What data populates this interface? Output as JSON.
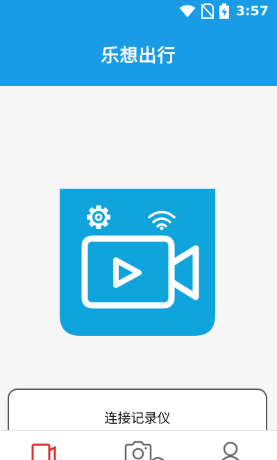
{
  "status_bar": {
    "time": "3:57",
    "icons": [
      "wifi-icon",
      "no-sim-icon",
      "battery-charging-icon"
    ]
  },
  "header": {
    "title": "乐想出行"
  },
  "main": {
    "logo_icons": [
      "gear-icon",
      "wifi-icon",
      "video-camera-icon",
      "play-icon"
    ],
    "connect_button_label": "连接记录仪"
  },
  "tab_bar": {
    "tabs": [
      {
        "icon": "dashcam-icon",
        "active": true
      },
      {
        "icon": "camera-icon",
        "active": false
      },
      {
        "icon": "user-icon",
        "active": false
      }
    ],
    "active_color": "#d9302c",
    "inactive_color": "#666666"
  },
  "colors": {
    "primary": "#1a9be6",
    "logo_background": "#0fa5dc",
    "page_background": "#f6f6f6"
  }
}
